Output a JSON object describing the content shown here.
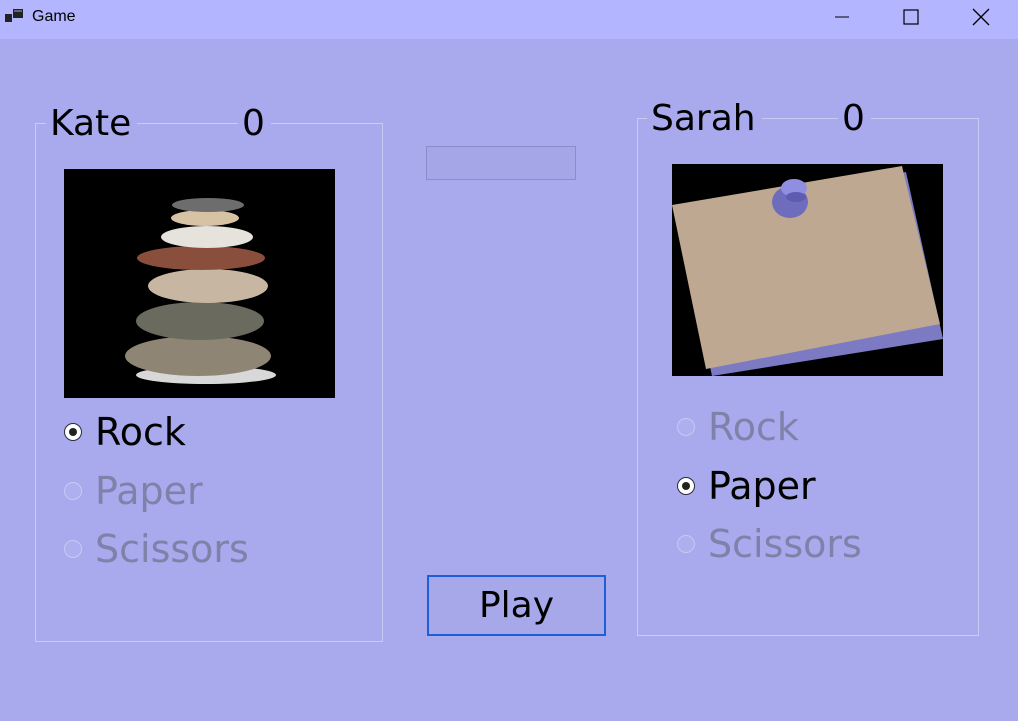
{
  "window": {
    "title": "Game",
    "controls": {
      "minimize": "minimize-icon",
      "maximize": "maximize-icon",
      "close": "close-icon"
    }
  },
  "player1": {
    "name": "Kate",
    "score": "0",
    "image": "rock-stack-image",
    "options": [
      {
        "label": "Rock",
        "checked": true,
        "enabled": true
      },
      {
        "label": "Paper",
        "checked": false,
        "enabled": false
      },
      {
        "label": "Scissors",
        "checked": false,
        "enabled": false
      }
    ]
  },
  "player2": {
    "name": "Sarah",
    "score": "0",
    "image": "pinned-paper-image",
    "options": [
      {
        "label": "Rock",
        "checked": false,
        "enabled": false
      },
      {
        "label": "Paper",
        "checked": true,
        "enabled": true
      },
      {
        "label": "Scissors",
        "checked": false,
        "enabled": false
      }
    ]
  },
  "result": {
    "text": ""
  },
  "play_button": {
    "label": "Play"
  },
  "colors": {
    "window_bg": "#a9aaee",
    "titlebar_bg": "#b3b5ff",
    "play_border": "#1d5fd6",
    "disabled_text": "#7f81a8"
  }
}
